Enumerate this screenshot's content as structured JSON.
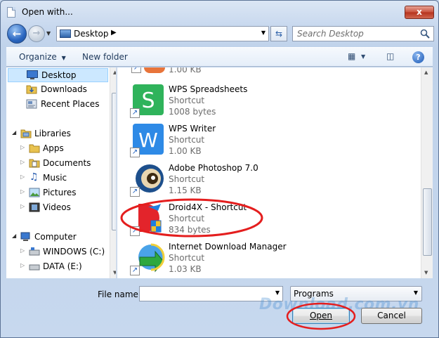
{
  "window": {
    "title": "Open with...",
    "close_label": "x"
  },
  "nav": {
    "address_location": "Desktop",
    "search_placeholder": "Search Desktop"
  },
  "toolbar": {
    "organize_label": "Organize",
    "new_folder_label": "New folder"
  },
  "sidebar": {
    "favorites": [
      {
        "label": "Desktop",
        "icon": "desktop-icon",
        "selected": true
      },
      {
        "label": "Downloads",
        "icon": "downloads-folder-icon"
      },
      {
        "label": "Recent Places",
        "icon": "recent-places-icon"
      }
    ],
    "libraries": {
      "label": "Libraries",
      "items": [
        {
          "label": "Apps",
          "icon": "folder-icon"
        },
        {
          "label": "Documents",
          "icon": "documents-icon"
        },
        {
          "label": "Music",
          "icon": "music-icon"
        },
        {
          "label": "Pictures",
          "icon": "pictures-icon"
        },
        {
          "label": "Videos",
          "icon": "videos-icon"
        }
      ]
    },
    "computer": {
      "label": "Computer",
      "items": [
        {
          "label": "WINDOWS (C:)",
          "icon": "drive-c-icon"
        },
        {
          "label": "DATA (E:)",
          "icon": "drive-e-icon"
        }
      ]
    }
  },
  "files": [
    {
      "name": "",
      "type": "",
      "size": "1.00 KB",
      "icon": "partial-app-icon"
    },
    {
      "name": "WPS Spreadsheets",
      "type": "Shortcut",
      "size": "1008 bytes",
      "icon": "wps-spreadsheets-icon"
    },
    {
      "name": "WPS Writer",
      "type": "Shortcut",
      "size": "1.00 KB",
      "icon": "wps-writer-icon"
    },
    {
      "name": "Adobe Photoshop 7.0",
      "type": "Shortcut",
      "size": "1.15 KB",
      "icon": "photoshop-icon"
    },
    {
      "name": "Droid4X - Shortcut",
      "type": "Shortcut",
      "size": "834 bytes",
      "icon": "droid4x-icon"
    },
    {
      "name": "Internet Download Manager",
      "type": "Shortcut",
      "size": "1.03 KB",
      "icon": "idm-icon"
    }
  ],
  "footer": {
    "filename_label": "File name:",
    "filename_value": "",
    "filter_value": "Programs",
    "open_label": "Open",
    "cancel_label": "Cancel"
  },
  "watermark": {
    "text": "Download.com.vn",
    "dot_colors": [
      "#e94b3c",
      "#f5a623",
      "#2bb24c",
      "#2d7be5",
      "#9b59b6"
    ]
  },
  "colors": {
    "accent": "#3c7fb1",
    "selection": "#cce8ff",
    "annotation": "#e41e1e"
  }
}
